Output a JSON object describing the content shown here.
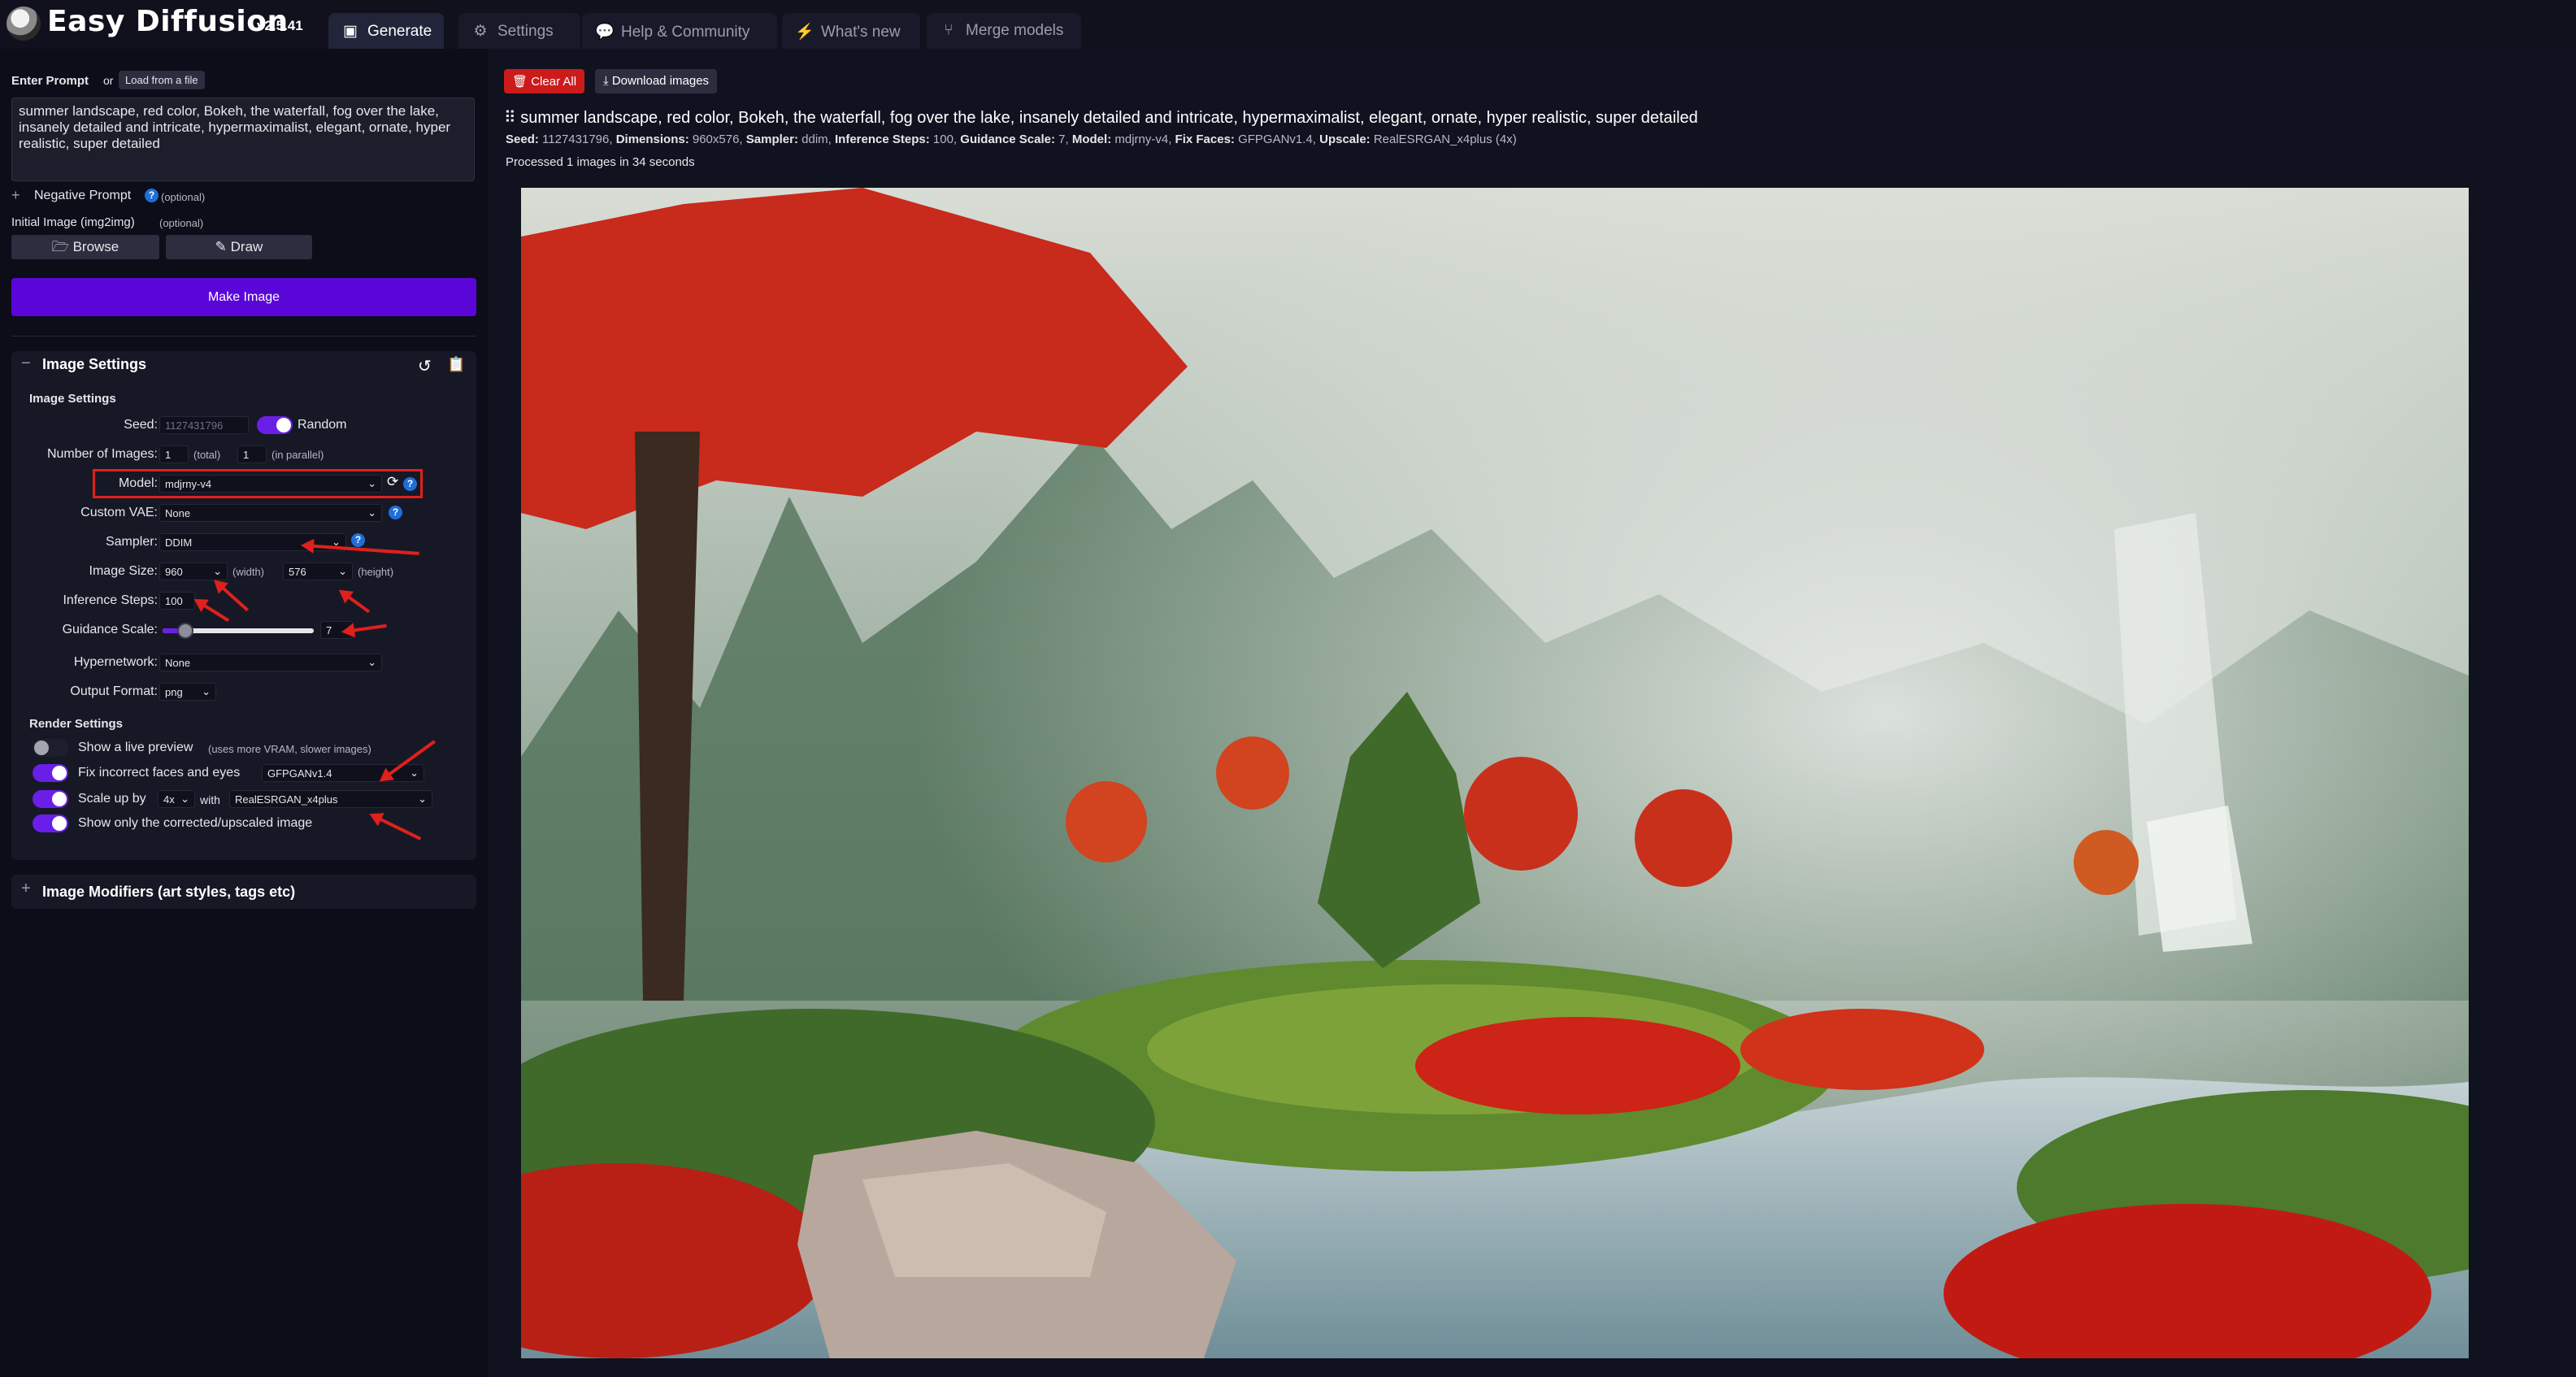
{
  "app": {
    "title": "Easy Diffusion",
    "version": "v2.5.41"
  },
  "tabs": [
    {
      "label": "Generate",
      "icon": "image-icon"
    },
    {
      "label": "Settings",
      "icon": "gear-icon"
    },
    {
      "label": "Help & Community",
      "icon": "chat-icon"
    },
    {
      "label": "What's new",
      "icon": "bolt-icon"
    },
    {
      "label": "Merge models",
      "icon": "merge-icon"
    }
  ],
  "prompt": {
    "label": "Enter Prompt",
    "or": "or",
    "load_file": "Load from a file",
    "value": "summer landscape, red color, Bokeh, the waterfall, fog over the lake, insanely detailed and intricate, hypermaximalist, elegant, ornate, hyper realistic, super detailed",
    "negative_label": "Negative Prompt",
    "negative_optional": "(optional)",
    "init_image_label": "Initial Image (img2img)",
    "init_image_optional": "(optional)",
    "browse": "Browse",
    "draw": "Draw",
    "make_image": "Make Image"
  },
  "image_settings": {
    "panel_title": "Image Settings",
    "section_title": "Image Settings",
    "seed_label": "Seed:",
    "seed_value": "1127431796",
    "random_label": "Random",
    "num_images_label": "Number of Images:",
    "num_total": "1",
    "total_label": "(total)",
    "num_parallel": "1",
    "parallel_label": "(in parallel)",
    "model_label": "Model:",
    "model_value": "mdjrny-v4",
    "vae_label": "Custom VAE:",
    "vae_value": "None",
    "sampler_label": "Sampler:",
    "sampler_value": "DDIM",
    "size_label": "Image Size:",
    "width_value": "960",
    "width_label": "(width)",
    "height_value": "576",
    "height_label": "(height)",
    "steps_label": "Inference Steps:",
    "steps_value": "100",
    "guidance_label": "Guidance Scale:",
    "guidance_value": "7",
    "guidance_fraction": 0.15,
    "hypernetwork_label": "Hypernetwork:",
    "hypernetwork_value": "None",
    "output_label": "Output Format:",
    "output_value": "png"
  },
  "render_settings": {
    "title": "Render Settings",
    "live_preview": "Show a live preview",
    "live_preview_note": "(uses more VRAM, slower images)",
    "fix_faces": "Fix incorrect faces and eyes",
    "fix_faces_model": "GFPGANv1.4",
    "scale_up": "Scale up by",
    "scale_value": "4x",
    "with": "with",
    "upscaler": "RealESRGAN_x4plus",
    "only_corrected": "Show only the corrected/upscaled image"
  },
  "modifiers": {
    "title": "Image Modifiers (art styles, tags etc)"
  },
  "results": {
    "clear_all": "Clear All",
    "download": "Download images",
    "prompt": "summer landscape, red color, Bokeh, the waterfall, fog over the lake, insanely detailed and intricate, hypermaximalist, elegant, ornate, hyper realistic, super detailed",
    "seed_k": "Seed:",
    "seed_v": "1127431796,",
    "dim_k": "Dimensions:",
    "dim_v": "960x576,",
    "sampler_k": "Sampler:",
    "sampler_v": "ddim,",
    "steps_k": "Inference Steps:",
    "steps_v": "100,",
    "guidance_k": "Guidance Scale:",
    "guidance_v": "7,",
    "model_k": "Model:",
    "model_v": "mdjrny-v4,",
    "faces_k": "Fix Faces:",
    "faces_v": "GFPGANv1.4,",
    "upscale_k": "Upscale:",
    "upscale_v": "RealESRGAN_x4plus (4x)",
    "processed": "Processed 1 images in 34 seconds"
  },
  "colors": {
    "accent": "#5b06d9",
    "danger": "#cc1b1b",
    "highlight": "#e0201c",
    "help": "#1e6fd9"
  }
}
